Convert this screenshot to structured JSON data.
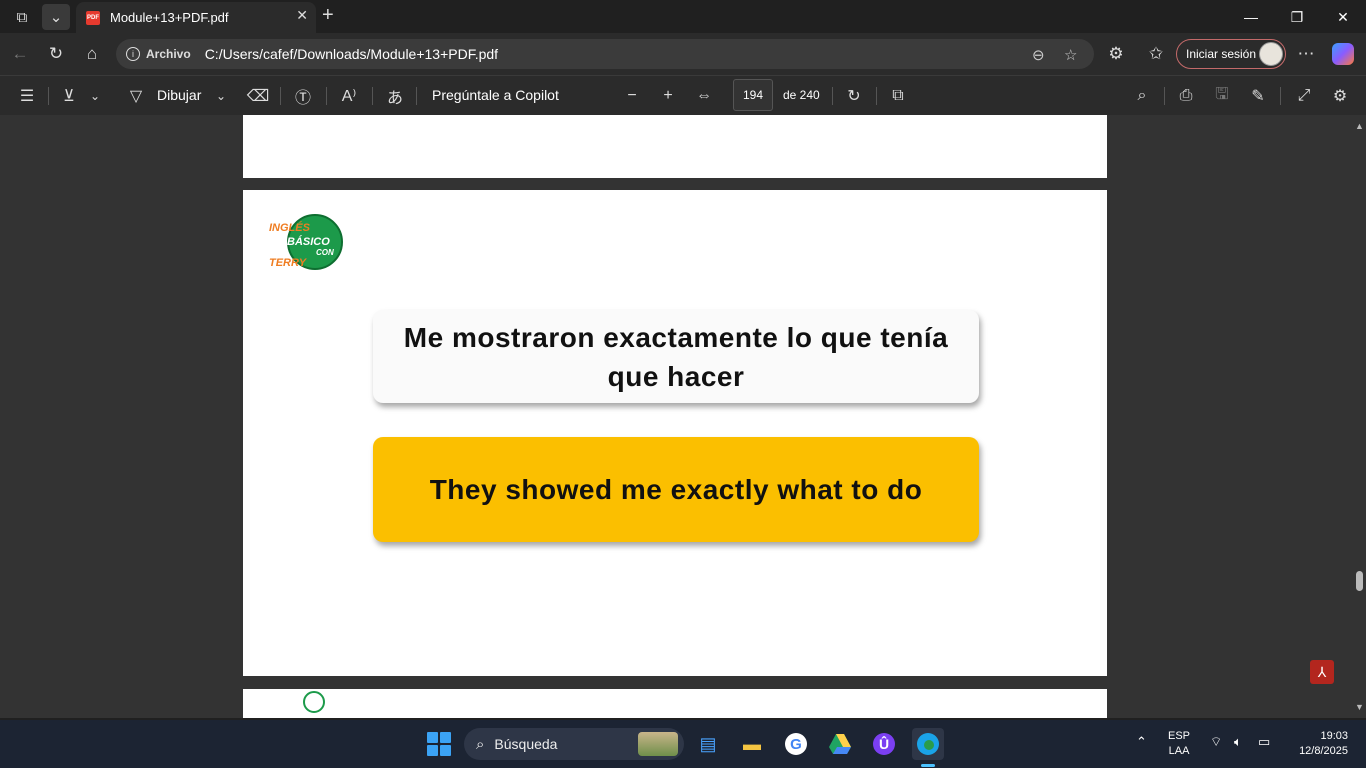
{
  "titlebar": {
    "tab_title": "Module+13+PDF.pdf",
    "tab_icon": "pdf-icon",
    "pdf_badge": "PDF",
    "window_controls": [
      "minimize",
      "restore",
      "close"
    ]
  },
  "address_bar": {
    "site_label": "Archivo",
    "url": "C:/Users/cafef/Downloads/Module+13+PDF.pdf",
    "signin_label": "Iniciar sesión"
  },
  "pdf_toolbar": {
    "draw_label": "Dibujar",
    "copilot_label": "Pregúntale a Copilot",
    "current_page": "194",
    "page_total": "de 240"
  },
  "document": {
    "logo": {
      "line1": "INGLÉS",
      "line2": "BÁSICO",
      "line3": "CON",
      "line4": "TERRY"
    },
    "spanish_sentence": "Me mostraron exactamente lo que tenía que hacer",
    "english_sentence": "They showed me exactly what to do"
  },
  "taskbar": {
    "search_placeholder": "Búsqueda",
    "apps": [
      "notepad-icon",
      "file-explorer-icon",
      "chrome-icon",
      "google-drive-icon",
      "proton-vpn-icon",
      "edge-icon"
    ],
    "language_line1": "ESP",
    "language_line2": "LAA",
    "time": "19:03",
    "date": "12/8/2025"
  },
  "colors": {
    "english_card": "#fbbf00",
    "spanish_card": "#fafafa",
    "viewer_bg": "#333333",
    "taskbar_bg": "#1c2433"
  }
}
